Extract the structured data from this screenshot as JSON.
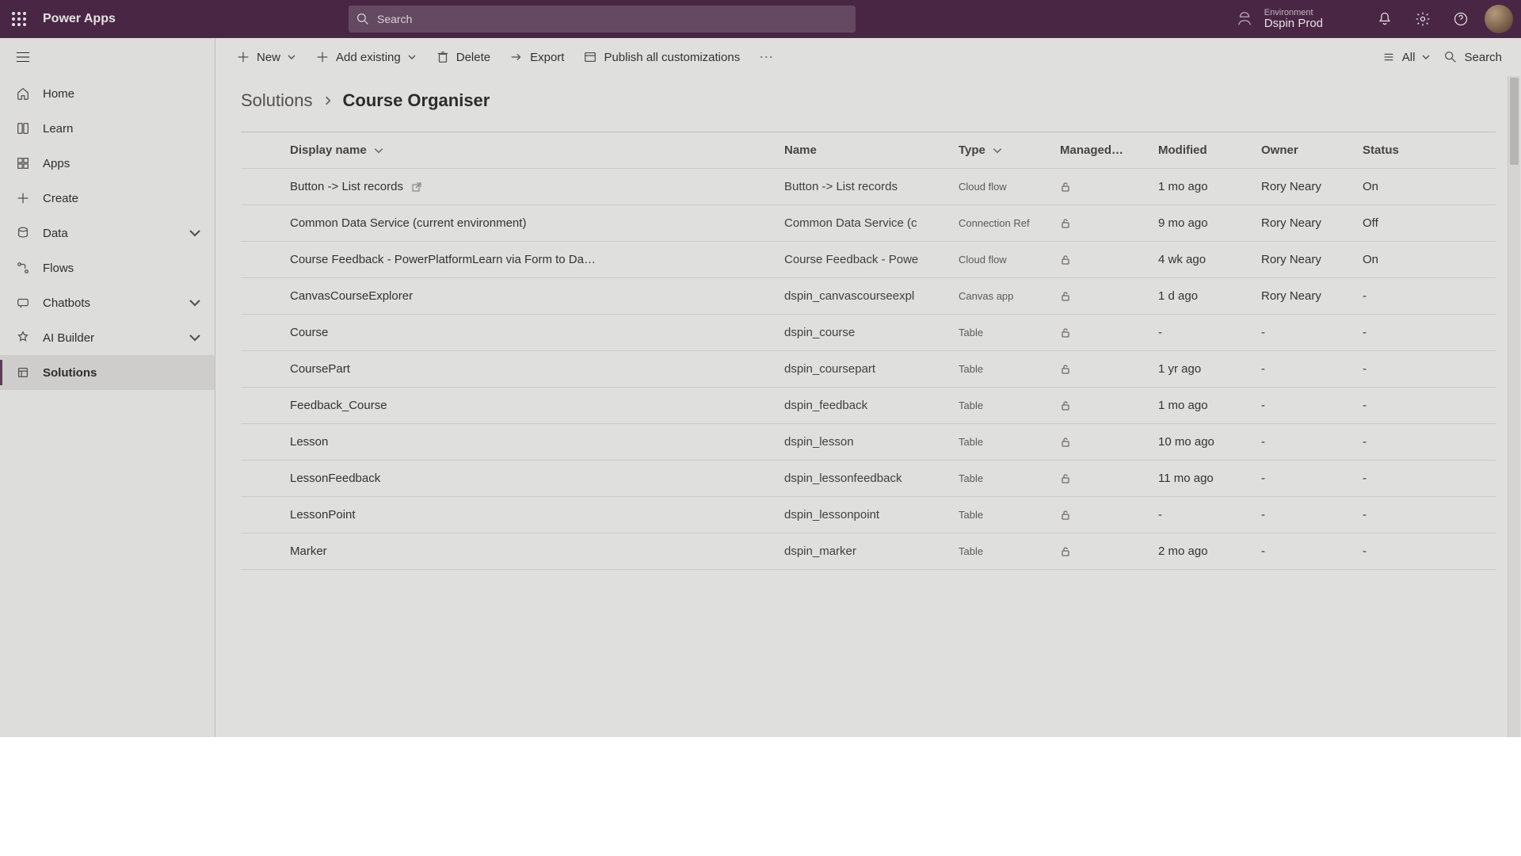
{
  "suite": {
    "app_title": "Power Apps",
    "search_placeholder": "Search",
    "env_label": "Environment",
    "env_name": "Dspin Prod"
  },
  "nav": {
    "items": [
      {
        "id": "home",
        "label": "Home"
      },
      {
        "id": "learn",
        "label": "Learn"
      },
      {
        "id": "apps",
        "label": "Apps"
      },
      {
        "id": "create",
        "label": "Create"
      },
      {
        "id": "data",
        "label": "Data",
        "expandable": true
      },
      {
        "id": "flows",
        "label": "Flows"
      },
      {
        "id": "chatbots",
        "label": "Chatbots",
        "expandable": true
      },
      {
        "id": "aibuilder",
        "label": "AI Builder",
        "expandable": true
      },
      {
        "id": "solutions",
        "label": "Solutions",
        "selected": true
      }
    ]
  },
  "cmdbar": {
    "new": "New",
    "add_existing": "Add existing",
    "delete": "Delete",
    "export": "Export",
    "publish": "Publish all customizations",
    "view_all": "All",
    "search": "Search"
  },
  "breadcrumb": {
    "root": "Solutions",
    "current": "Course Organiser"
  },
  "columns": {
    "display": "Display name",
    "name": "Name",
    "type": "Type",
    "managed": "Managed…",
    "modified": "Modified",
    "owner": "Owner",
    "status": "Status"
  },
  "rows": [
    {
      "display": "Button -> List records",
      "ext": true,
      "name": "Button -> List records",
      "type": "Cloud flow",
      "modified": "1 mo ago",
      "owner": "Rory Neary",
      "status": "On"
    },
    {
      "display": "Common Data Service (current environment)",
      "name": "Common Data Service (c",
      "type": "Connection Ref",
      "modified": "9 mo ago",
      "owner": "Rory Neary",
      "status": "Off"
    },
    {
      "display": "Course Feedback - PowerPlatformLearn via Form to Da…",
      "name": "Course Feedback - Powe",
      "type": "Cloud flow",
      "modified": "4 wk ago",
      "owner": "Rory Neary",
      "status": "On"
    },
    {
      "display": "CanvasCourseExplorer",
      "name": "dspin_canvascourseexpl",
      "type": "Canvas app",
      "modified": "1 d ago",
      "owner": "Rory Neary",
      "status": "-"
    },
    {
      "display": "Course",
      "name": "dspin_course",
      "type": "Table",
      "modified": "-",
      "owner": "-",
      "status": "-"
    },
    {
      "display": "CoursePart",
      "name": "dspin_coursepart",
      "type": "Table",
      "modified": "1 yr ago",
      "owner": "-",
      "status": "-"
    },
    {
      "display": "Feedback_Course",
      "name": "dspin_feedback",
      "type": "Table",
      "modified": "1 mo ago",
      "owner": "-",
      "status": "-"
    },
    {
      "display": "Lesson",
      "name": "dspin_lesson",
      "type": "Table",
      "modified": "10 mo ago",
      "owner": "-",
      "status": "-"
    },
    {
      "display": "LessonFeedback",
      "name": "dspin_lessonfeedback",
      "type": "Table",
      "modified": "11 mo ago",
      "owner": "-",
      "status": "-"
    },
    {
      "display": "LessonPoint",
      "name": "dspin_lessonpoint",
      "type": "Table",
      "modified": "-",
      "owner": "-",
      "status": "-"
    },
    {
      "display": "Marker",
      "name": "dspin_marker",
      "type": "Table",
      "modified": "2 mo ago",
      "owner": "-",
      "status": "-"
    }
  ]
}
